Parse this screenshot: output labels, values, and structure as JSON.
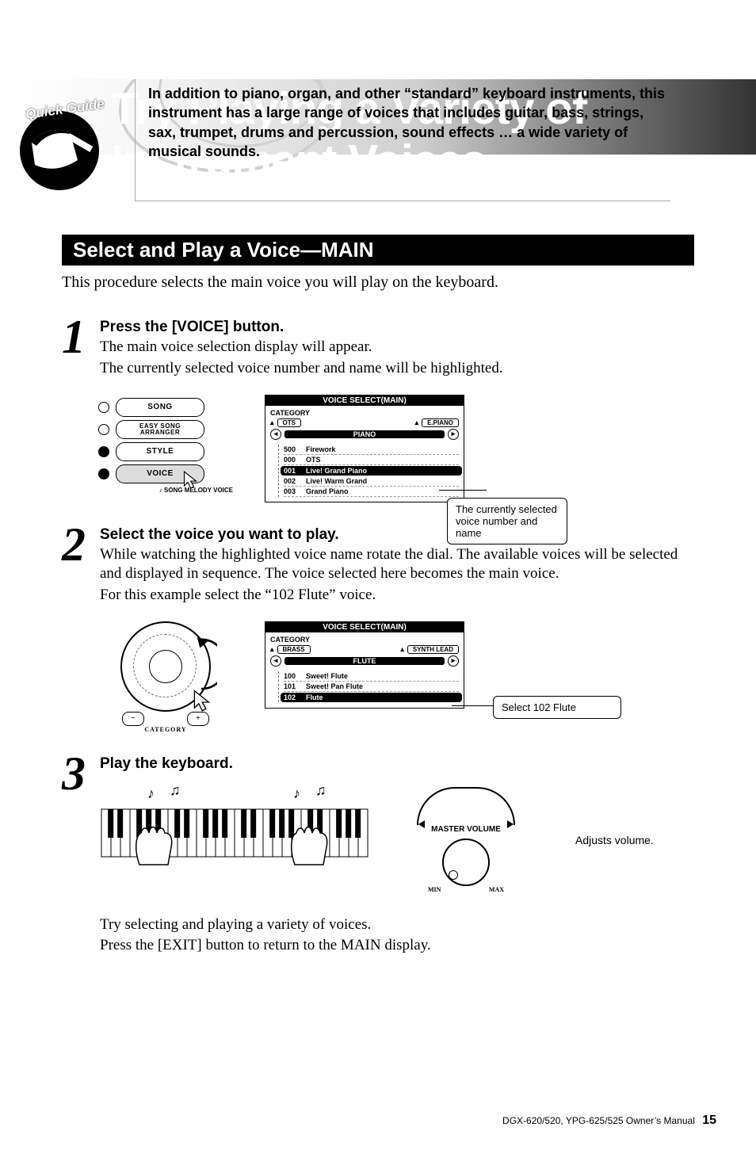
{
  "badge": "Quick Guide",
  "title": "Try Playing a Variety of Instrument Voices",
  "intro": "In addition to piano, organ, and other “standard” keyboard instruments, this instrument has a large range of voices that includes guitar, bass, strings, sax, trumpet, drums and percussion, sound effects … a wide variety of musical sounds.",
  "section_title": "Select and Play a Voice—MAIN",
  "section_lead": "This procedure selects the main voice you will play on the keyboard.",
  "steps": {
    "s1": {
      "num": "1",
      "title": "Press the [VOICE] button.",
      "body1": "The main voice selection display will appear.",
      "body2": "The currently selected voice number and name will be highlighted.",
      "panel": {
        "btn1": "SONG",
        "btn2a": "EASY SONG",
        "btn2b": "ARRANGER",
        "btn3": "STYLE",
        "btn4": "VOICE",
        "sub": "♪ SONG MELODY VOICE"
      },
      "lcd": {
        "bar": "VOICE SELECT(MAIN)",
        "cat": "CATEGORY",
        "left": "OTS",
        "right": "E.PIANO",
        "center": "PIANO",
        "rows": [
          {
            "n": "500",
            "t": "Firework"
          },
          {
            "n": "000",
            "t": "OTS"
          },
          {
            "n": "001",
            "t": "Live! Grand Piano",
            "sel": true
          },
          {
            "n": "002",
            "t": "Live! Warm Grand"
          },
          {
            "n": "003",
            "t": "Grand Piano"
          }
        ]
      },
      "callout": "The currently selected voice number and name"
    },
    "s2": {
      "num": "2",
      "title": "Select the voice you want to play.",
      "body1": "While watching the highlighted voice name rotate the dial. The available voices will be selected and displayed in sequence. The voice selected here becomes the main voice.",
      "body2": "For this example select the “102 Flute” voice.",
      "dial_label": "CATEGORY",
      "lcd": {
        "bar": "VOICE SELECT(MAIN)",
        "cat": "CATEGORY",
        "left": "BRASS",
        "right": "SYNTH LEAD",
        "center": "FLUTE",
        "rows": [
          {
            "n": "100",
            "t": "Sweet! Flute"
          },
          {
            "n": "101",
            "t": "Sweet! Pan Flute"
          },
          {
            "n": "102",
            "t": "Flute",
            "sel": true
          }
        ]
      },
      "callout": "Select 102 Flute"
    },
    "s3": {
      "num": "3",
      "title": "Play the keyboard.",
      "vol_label": "MASTER VOLUME",
      "vol_min": "MIN",
      "vol_max": "MAX",
      "caption": "Adjusts volume.",
      "body1": "Try selecting and playing a variety of voices.",
      "body2": "Press the [EXIT] button to return to the MAIN display."
    }
  },
  "footer": {
    "model": "DGX-620/520, YPG-625/525  Owner’s Manual",
    "page": "15"
  }
}
